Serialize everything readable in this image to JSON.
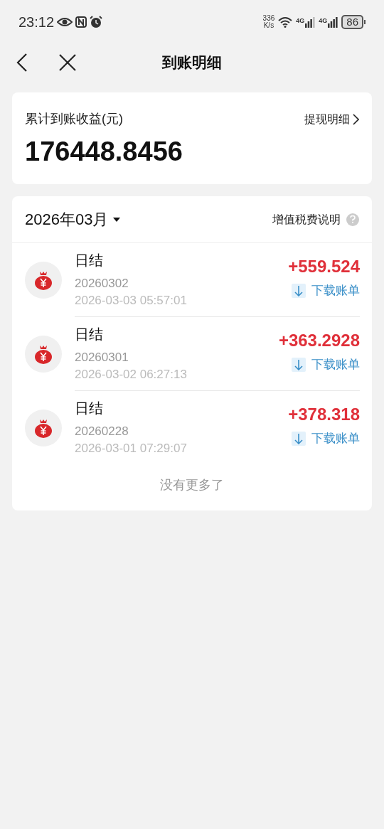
{
  "status_bar": {
    "time": "23:12",
    "speed": [
      "336",
      "K/s"
    ],
    "network": [
      "4G",
      "4G"
    ],
    "battery": "86"
  },
  "header": {
    "title": "到账明细"
  },
  "summary": {
    "label": "累计到账收益(元)",
    "link": "提现明细",
    "amount": "176448.8456"
  },
  "list": {
    "month": "2026年03月",
    "tax_link": "增值税费说明",
    "items": [
      {
        "title": "日结",
        "date": "20260302",
        "time": "2026-03-03 05:57:01",
        "amount": "+559.524",
        "action": "下载账单"
      },
      {
        "title": "日结",
        "date": "20260301",
        "time": "2026-03-02 06:27:13",
        "amount": "+363.2928",
        "action": "下载账单"
      },
      {
        "title": "日结",
        "date": "20260228",
        "time": "2026-03-01 07:29:07",
        "amount": "+378.318",
        "action": "下载账单"
      }
    ],
    "footer": "没有更多了"
  }
}
